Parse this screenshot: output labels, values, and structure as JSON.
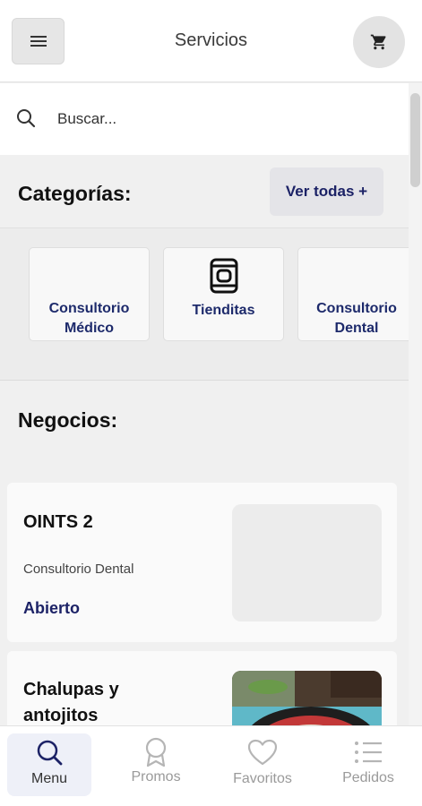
{
  "header": {
    "title": "Servicios",
    "menu_icon": "hamburger-icon",
    "cart_icon": "cart-icon"
  },
  "search": {
    "placeholder": "Buscar..."
  },
  "categories": {
    "title": "Categorías:",
    "see_all": "Ver todas +",
    "items": [
      {
        "label_line1": "Consultorio",
        "label_line2": "Médico",
        "icon": ""
      },
      {
        "label_line1": "Tienditas",
        "label_line2": "",
        "icon": "can-icon"
      },
      {
        "label_line1": "Consultorio",
        "label_line2": "Dental",
        "icon": ""
      }
    ]
  },
  "businesses": {
    "title": "Negocios:",
    "items": [
      {
        "name": "OINTS 2",
        "category": "Consultorio Dental",
        "status": "Abierto"
      },
      {
        "name_line1": "Chalupas y",
        "name_line2": "antojitos"
      }
    ]
  },
  "nav": {
    "items": [
      {
        "label": "Menu",
        "icon": "search-icon",
        "active": true
      },
      {
        "label": "Promos",
        "icon": "award-icon",
        "active": false
      },
      {
        "label": "Favoritos",
        "icon": "heart-icon",
        "active": false
      },
      {
        "label": "Pedidos",
        "icon": "list-icon",
        "active": false
      }
    ]
  },
  "colors": {
    "accent": "#1c2266",
    "background": "#f0f0f0",
    "card": "#fafafa"
  }
}
